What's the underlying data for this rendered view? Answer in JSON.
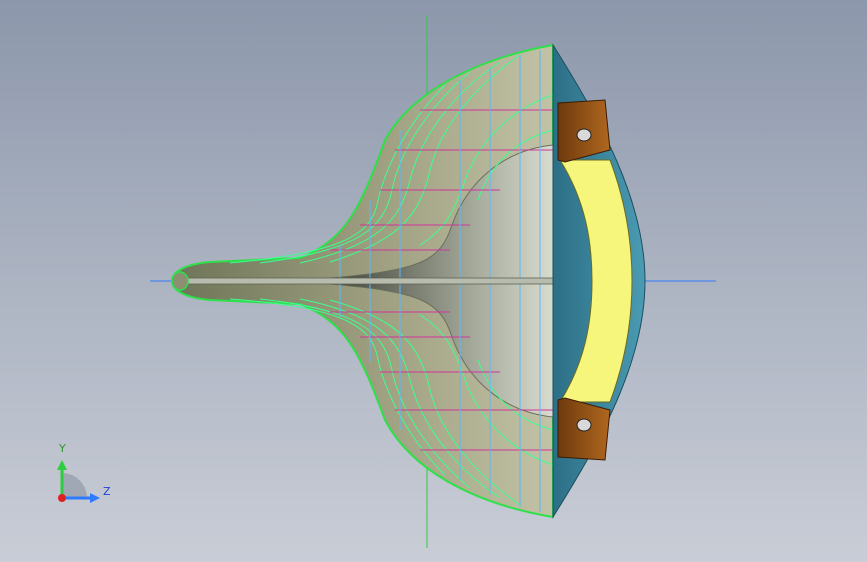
{
  "triad": {
    "y_label": "Y",
    "z_label": "Z"
  },
  "colors": {
    "background_top": "#8c97ab",
    "background_bottom": "#c9cdd6",
    "surface": "#8c8f72",
    "edge_highlight": "#2ee04a",
    "isoline_green": "#3dff8e",
    "isoline_magenta": "#d0349a",
    "isoline_blue": "#5ab8ff",
    "lens_yellow": "#f6f57c",
    "lens_teal": "#3d8aa3",
    "mount_bronze": "#8a4a12",
    "axis_green": "#2ecc40",
    "axis_blue": "#2f7bff"
  },
  "icons": [
    "coordinate-triad-icon"
  ]
}
